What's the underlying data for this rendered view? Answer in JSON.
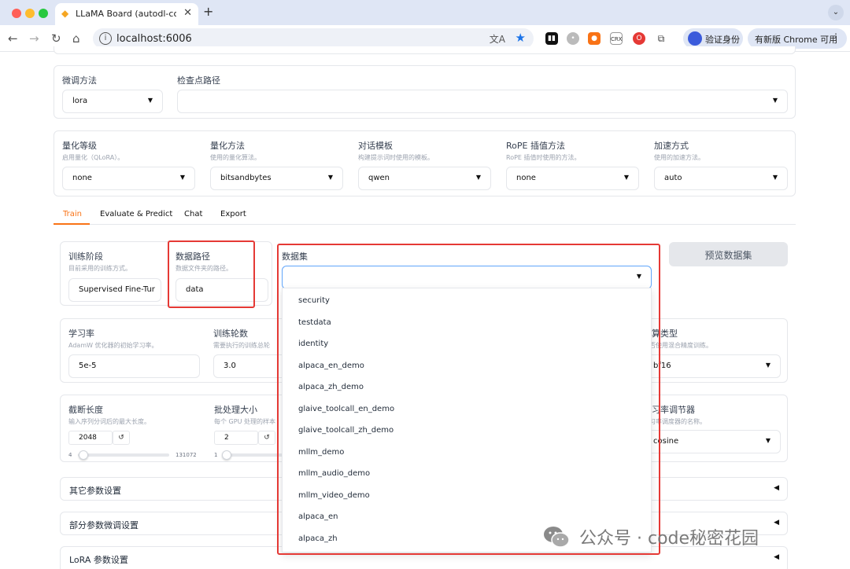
{
  "browser": {
    "tab_title": "LLaMA Board (autodl-contai",
    "url": "localhost:6006",
    "profile_label": "验证身份",
    "update_label": "有新版 Chrome 可用",
    "extensions": [
      "extension-1",
      "extension-2",
      "extension-3",
      "CRX",
      "extension-5",
      "puzzle"
    ]
  },
  "top_row": {
    "finetune_label": "微调方法",
    "finetune_value": "lora",
    "checkpoint_label": "检查点路径",
    "checkpoint_value": ""
  },
  "quant_row": [
    {
      "label": "量化等级",
      "hint": "启用量化（QLoRA）。",
      "value": "none"
    },
    {
      "label": "量化方法",
      "hint": "使用的量化算法。",
      "value": "bitsandbytes"
    },
    {
      "label": "对话模板",
      "hint": "构建提示词时使用的模板。",
      "value": "qwen"
    },
    {
      "label": "RoPE 插值方法",
      "hint": "RoPE 插值时使用的方法。",
      "value": "none"
    },
    {
      "label": "加速方式",
      "hint": "使用的加速方法。",
      "value": "auto"
    }
  ],
  "tabs": [
    "Train",
    "Evaluate & Predict",
    "Chat",
    "Export"
  ],
  "active_tab": "Train",
  "train": {
    "stage_label": "训练阶段",
    "stage_hint": "目前采用的训练方式。",
    "stage_value": "Supervised Fine-Tur",
    "datapath_label": "数据路径",
    "datapath_hint": "数据文件夹的路径。",
    "datapath_value": "data",
    "dataset_label": "数据集",
    "preview_button": "预览数据集"
  },
  "dataset_options": [
    "security",
    "testdata",
    "identity",
    "alpaca_en_demo",
    "alpaca_zh_demo",
    "glaive_toolcall_en_demo",
    "glaive_toolcall_zh_demo",
    "mllm_demo",
    "mllm_audio_demo",
    "mllm_video_demo",
    "alpaca_en",
    "alpaca_zh"
  ],
  "lr_row": {
    "lr_label": "学习率",
    "lr_hint": "AdamW 优化器的初始学习率。",
    "lr_value": "5e-5",
    "epochs_label": "训练轮数",
    "epochs_hint": "需要执行的训练总轮",
    "epochs_value": "3.0",
    "compute_label": "计算类型",
    "compute_hint": "是否使用混合精度训练。",
    "compute_value": "bf16"
  },
  "len_row": {
    "cutoff_label": "截断长度",
    "cutoff_hint": "输入序列分词后的最大长度。",
    "cutoff_value": "2048",
    "cutoff_min": "4",
    "cutoff_max": "131072",
    "cutoff_fraction": 0.015,
    "batch_label": "批处理大小",
    "batch_hint": "每个 GPU 处理的样本",
    "batch_value": "2",
    "batch_min": "1",
    "batch_fraction": 0.02,
    "sched_label": "学习率调节器",
    "sched_hint": "学习率调度器的名称。",
    "sched_value": "cosine"
  },
  "sections": [
    "其它参数设置",
    "部分参数微调设置",
    "LoRA 参数设置"
  ],
  "watermark": "公众号 · code秘密花园"
}
